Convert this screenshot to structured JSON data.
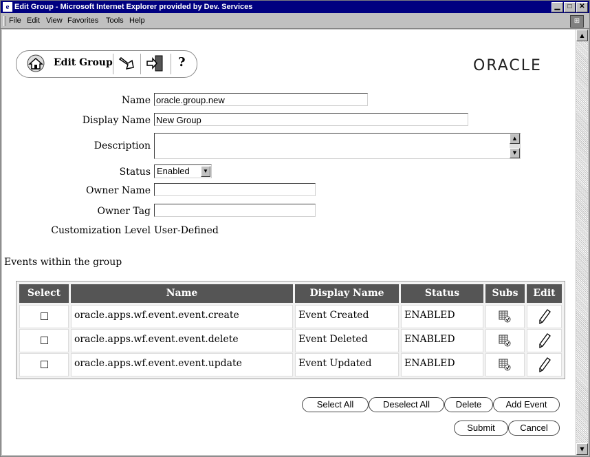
{
  "window": {
    "title": "Edit Group - Microsoft Internet Explorer provided by Dev. Services",
    "buttons": [
      "minimize",
      "maximize",
      "close"
    ]
  },
  "menu": [
    "File",
    "Edit",
    "View",
    "Favorites",
    "Tools",
    "Help"
  ],
  "toolbar": {
    "label": "Edit Group",
    "help": "?"
  },
  "brand": {
    "logo_text": "ORACLE"
  },
  "form": {
    "name_label": "Name",
    "name_value": "oracle.group.new",
    "display_name_label": "Display Name",
    "display_name_value": "New Group",
    "description_label": "Description",
    "description_value": "",
    "status_label": "Status",
    "status_value": "Enabled",
    "owner_name_label": "Owner Name",
    "owner_name_value": "",
    "owner_tag_label": "Owner Tag",
    "owner_tag_value": "",
    "customization_label": "Customization Level",
    "customization_value": "User-Defined"
  },
  "events": {
    "section_title": "Events within the group",
    "columns": [
      "Select",
      "Name",
      "Display Name",
      "Status",
      "Subs",
      "Edit"
    ],
    "rows": [
      {
        "name": "oracle.apps.wf.event.event.create",
        "display_name": "Event Created",
        "status": "ENABLED",
        "checked": false
      },
      {
        "name": "oracle.apps.wf.event.event.delete",
        "display_name": "Event Deleted",
        "status": "ENABLED",
        "checked": false
      },
      {
        "name": "oracle.apps.wf.event.event.update",
        "display_name": "Event Updated",
        "status": "ENABLED",
        "checked": false
      }
    ]
  },
  "actions": {
    "select_all": "Select All",
    "deselect_all": "Deselect All",
    "delete": "Delete",
    "add_event": "Add Event",
    "submit": "Submit",
    "cancel": "Cancel"
  },
  "colors": {
    "titlebar": "#000080",
    "table_header": "#555555",
    "chrome": "#c0c0c0"
  }
}
